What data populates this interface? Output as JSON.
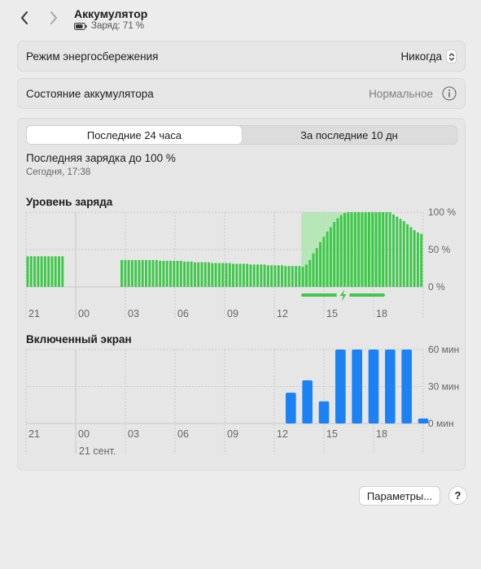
{
  "header": {
    "title": "Аккумулятор",
    "subtitle": "Заряд: 71 %"
  },
  "power_saving": {
    "label": "Режим энергосбережения",
    "value": "Никогда"
  },
  "battery_health": {
    "label": "Состояние аккумулятора",
    "value": "Нормальное"
  },
  "tabs": {
    "items": [
      "Последние 24 часа",
      "За последние 10 дн"
    ],
    "selected_index": 0
  },
  "last_charge": {
    "title": "Последняя зарядка до 100 %",
    "time": "Сегодня, 17:38"
  },
  "footer": {
    "options_button": "Параметры...",
    "help_button": "?"
  },
  "colors": {
    "battery_bar": "#3ec74a",
    "charging_zone": "#b8e7b7",
    "screen_bar": "#1a82f5",
    "grid": "#c8c8c8"
  },
  "chart_data": [
    {
      "type": "bar",
      "title": "Уровень заряда",
      "x_tick_labels": [
        "21",
        "00",
        "03",
        "06",
        "09",
        "12",
        "15",
        "18"
      ],
      "y_tick_labels": [
        "100 %",
        "50 %",
        "0 %"
      ],
      "ylim": [
        0,
        100
      ],
      "unit": "%",
      "interval_minutes": 15,
      "charging_period_bars": [
        79,
        103
      ],
      "values": [
        41,
        41,
        41,
        41,
        41,
        41,
        41,
        41,
        41,
        41,
        41,
        null,
        null,
        null,
        null,
        null,
        null,
        null,
        null,
        null,
        null,
        null,
        null,
        null,
        null,
        null,
        null,
        null,
        null,
        null,
        null,
        null,
        null,
        null,
        null,
        null,
        null,
        null,
        null,
        null,
        null,
        null,
        null,
        null,
        null,
        null,
        null,
        null,
        null,
        null,
        null,
        null,
        null,
        null,
        null,
        null,
        null,
        null,
        null,
        null,
        null,
        null,
        null,
        null,
        null,
        null,
        null,
        null,
        null,
        null,
        null,
        null,
        null,
        null,
        null,
        null,
        null,
        null,
        null,
        null,
        null,
        null,
        null,
        null,
        null,
        null,
        null,
        null,
        null,
        null,
        null,
        null,
        null,
        null,
        null,
        null,
        null,
        null,
        null,
        null,
        null,
        null,
        null,
        null,
        null,
        null,
        null,
        null,
        null,
        null,
        null
      ],
      "values_note": ""
    },
    {
      "type": "bar",
      "title": "Включенный экран",
      "x_tick_labels": [
        "21",
        "00",
        "03",
        "06",
        "09",
        "12",
        "15",
        "18"
      ],
      "date_label": "21 сент.",
      "y_tick_labels": [
        "60 мин",
        "30 мин",
        "0 мин"
      ],
      "ylim": [
        0,
        60
      ],
      "unit": "мин",
      "hourly_values": [
        0,
        0,
        0,
        0,
        0,
        0,
        0,
        0,
        0,
        0,
        0,
        0,
        0,
        0,
        0,
        0,
        25,
        35,
        18,
        60,
        60,
        60,
        60,
        60,
        4
      ]
    }
  ]
}
